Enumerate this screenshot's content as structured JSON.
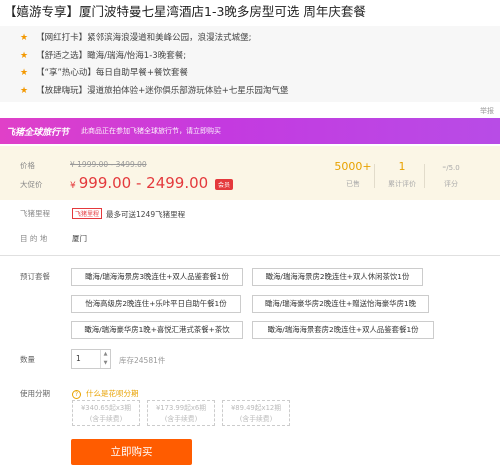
{
  "title": "【嬉游专享】厦门波特曼七星湾酒店1-3晚多房型可选 周年庆套餐",
  "features": [
    "【网红打卡】紧邻滨海浪漫道和美峰公园，浪漫法式城堡;",
    "【舒适之选】瞰海/瑞海/怡海1-3晚套餐;",
    "【“享”热心动】每日自助早餐+餐饮套餐",
    "【放肆嗨玩】漫道旅拍体验+迷你俱乐部游玩体验+七星乐园淘气堡"
  ],
  "more_label": "举报",
  "promo": {
    "title": "飞猪全球旅行节",
    "desc": "此商品正在参加飞猪全球旅行节，请立即购买"
  },
  "price": {
    "label_price": "价格",
    "original": "¥ 1999.00 - 3499.00",
    "label_sale": "大促价",
    "yen": "¥",
    "current": "999.00 - 2499.00",
    "app_badge": "会员"
  },
  "stats": {
    "sold_value": "5000+",
    "sold_label": "已售",
    "reviews_value": "1",
    "reviews_label": "累计评价",
    "rating_value": "-",
    "rating_max": "/5.0",
    "rating_label": "评分"
  },
  "fliggy": {
    "label": "飞猪里程",
    "badge": "飞猪里程",
    "text": "最多可送1249飞猪里程"
  },
  "destination": {
    "label": "目 的 地",
    "value": "厦门"
  },
  "packages": {
    "label": "预订套餐",
    "items": [
      "瞰海/瑞海海景房3晚连住+双人品鉴套餐1份",
      "瞰海/瑞海海景房2晚连住+双人休闲茶饮1份",
      "怡海高级房2晚连住+乐咔平日自助午餐1份",
      "瞰海/瑞海豪华房2晚连住+赠送怡海豪华房1晚",
      "瞰海/瑞海豪华房1晚+喜悦汇港式茶餐+茶饮",
      "瞰海/瑞海海景套房2晚连住+双人品鉴套餐1份"
    ]
  },
  "quantity": {
    "label": "数量",
    "value": "1",
    "stock": "库存24581件"
  },
  "installment": {
    "label": "使用分期",
    "help": "什么是花呗分期",
    "options": [
      {
        "amount": "¥340.65起x3期",
        "fee": "(含手续费)"
      },
      {
        "amount": "¥173.99起x6期",
        "fee": "(含手续费)"
      },
      {
        "amount": "¥89.49起x12期",
        "fee": "(含手续费)"
      }
    ]
  },
  "buy_label": "立即购买",
  "colors": {
    "accent": "#ff5c00",
    "price_red": "#e4393c",
    "promo_purple": "#c43ae0",
    "gold": "#e8a200"
  }
}
